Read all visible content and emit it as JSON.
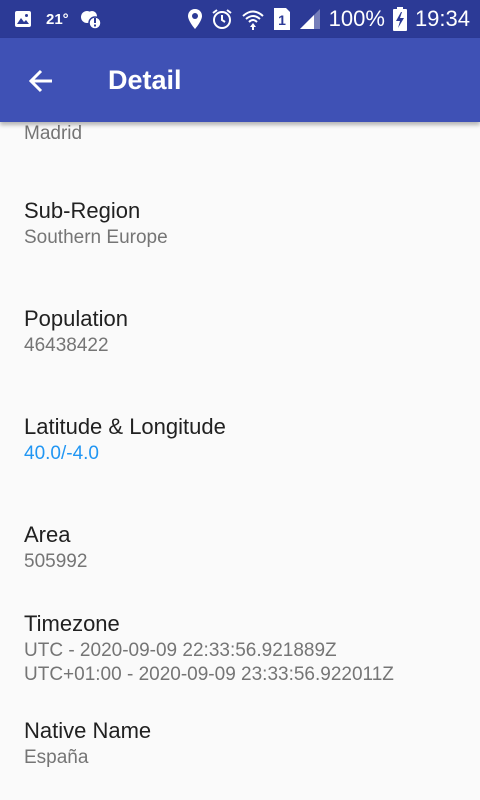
{
  "status_bar": {
    "temperature": "21°",
    "battery": "100%",
    "sim_slot": "1",
    "time": "19:34",
    "bg_color": "#2c3a96",
    "icons": [
      "gallery-icon",
      "weather-icon",
      "alert-icon",
      "location-icon",
      "alarm-icon",
      "wifi-icon",
      "sim-icon",
      "signal-icon",
      "battery-charging-icon"
    ]
  },
  "app_bar": {
    "title": "Detail",
    "back_icon": "arrow-back-icon",
    "color": "#3f51b5"
  },
  "details": {
    "capital_value": "Madrid",
    "subregion": {
      "label": "Sub-Region",
      "value": "Southern Europe"
    },
    "population": {
      "label": "Population",
      "value": "46438422"
    },
    "latlng": {
      "label": "Latitude & Longitude",
      "value": "40.0/-4.0",
      "value_color": "#2196f3"
    },
    "area": {
      "label": "Area",
      "value": "505992"
    },
    "timezone": {
      "label": "Timezone",
      "values": [
        "UTC - 2020-09-09 22:33:56.921889Z",
        "UTC+01:00 - 2020-09-09 23:33:56.922011Z"
      ]
    },
    "native_name": {
      "label": "Native Name",
      "value": "España"
    }
  }
}
